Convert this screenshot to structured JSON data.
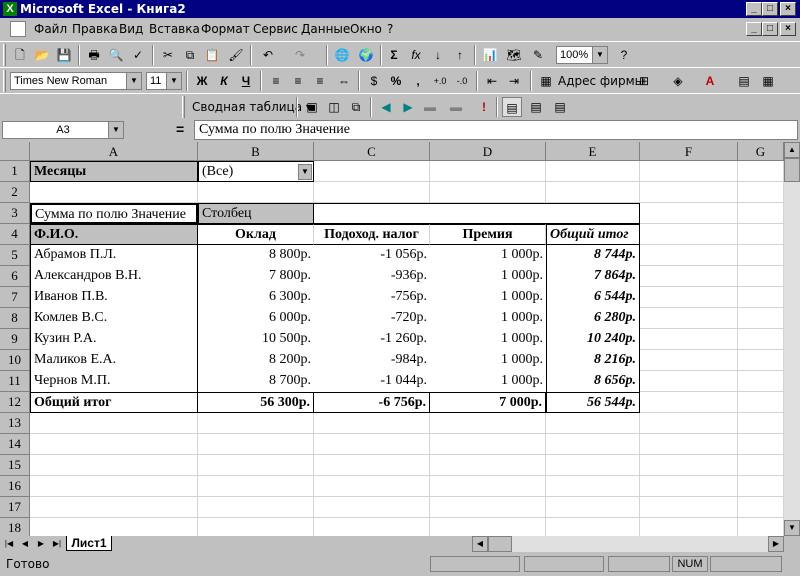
{
  "window": {
    "title": "Microsoft Excel - Книга2"
  },
  "menu": [
    "Файл",
    "Правка",
    "Вид",
    "Вставка",
    "Формат",
    "Сервис",
    "Данные",
    "Окно",
    "?"
  ],
  "toolbar": {
    "zoom": "100%",
    "font_name": "Times New Roman",
    "font_size": "11",
    "bold_label": "Ж",
    "italic_label": "К",
    "underline_label": "Ч",
    "percent_label": "%",
    "thousands_label": ",",
    "address_label": "Адрес фирмы",
    "sigma_label": "Σ",
    "fx_label": "fx"
  },
  "pivot_toolbar": {
    "label": "Сводная таблица ▾"
  },
  "formula": {
    "cell_ref": "A3",
    "equals": "=",
    "content": "Сумма по полю Значение"
  },
  "columns": [
    "A",
    "B",
    "C",
    "D",
    "E",
    "F",
    "G"
  ],
  "rows": [
    "1",
    "2",
    "3",
    "4",
    "5",
    "6",
    "7",
    "8",
    "9",
    "10",
    "11",
    "12",
    "13",
    "14",
    "15",
    "16",
    "17",
    "18"
  ],
  "sheet": {
    "months_label": "Месяцы",
    "months_value": "(Все)",
    "sum_label": "Сумма по полю Значение",
    "column_label": "Столбец",
    "headers": [
      "Ф.И.О.",
      "Оклад",
      "Подоход. налог",
      "Премия",
      "Общий итог"
    ],
    "data": [
      [
        "Абрамов П.Л.",
        "8 800р.",
        "-1 056р.",
        "1 000р.",
        "8 744р."
      ],
      [
        "Александров В.Н.",
        "7 800р.",
        "-936р.",
        "1 000р.",
        "7 864р."
      ],
      [
        "Иванов П.В.",
        "6 300р.",
        "-756р.",
        "1 000р.",
        "6 544р."
      ],
      [
        "Комлев В.С.",
        "6 000р.",
        "-720р.",
        "1 000р.",
        "6 280р."
      ],
      [
        "Кузин Р.А.",
        "10 500р.",
        "-1 260р.",
        "1 000р.",
        "10 240р."
      ],
      [
        "Маликов Е.А.",
        "8 200р.",
        "-984р.",
        "1 000р.",
        "8 216р."
      ],
      [
        "Чернов М.П.",
        "8 700р.",
        "-1 044р.",
        "1 000р.",
        "8 656р."
      ]
    ],
    "totals": [
      "Общий итог",
      "56 300р.",
      "-6 756р.",
      "7 000р.",
      "56 544р."
    ]
  },
  "tabs": {
    "sheet1": "Лист1"
  },
  "status": {
    "ready": "Готово",
    "num": "NUM"
  }
}
